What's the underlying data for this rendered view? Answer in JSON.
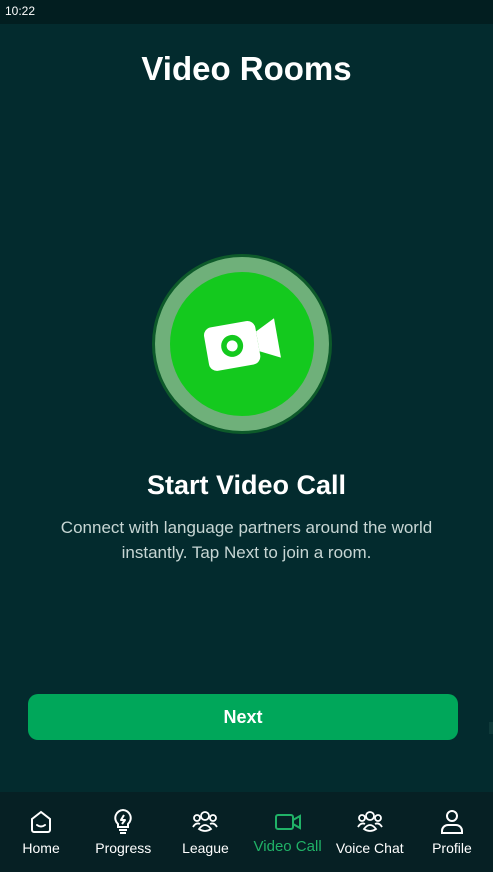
{
  "status_bar": {
    "time": "10:22"
  },
  "page": {
    "title": "Video Rooms"
  },
  "hero": {
    "icon": "video-camera-icon",
    "heading": "Start Video Call",
    "description_line1": "Connect with language partners around the world",
    "description_line2": "instantly. Tap Next to join a room."
  },
  "actions": {
    "next_label": "Next"
  },
  "bottom_nav": {
    "items": [
      {
        "label": "Home",
        "icon": "home-icon",
        "active": false
      },
      {
        "label": "Progress",
        "icon": "lightbulb-icon",
        "active": false
      },
      {
        "label": "League",
        "icon": "group-icon",
        "active": false
      },
      {
        "label": "Video Call",
        "icon": "video-camera-icon",
        "active": true
      },
      {
        "label": "Voice Chat",
        "icon": "group-icon",
        "active": false
      },
      {
        "label": "Profile",
        "icon": "person-icon",
        "active": false
      }
    ]
  },
  "colors": {
    "background": "#032b2e",
    "accent_green": "#14c91e",
    "button_green": "#00a75a",
    "active_nav": "#20b267"
  }
}
